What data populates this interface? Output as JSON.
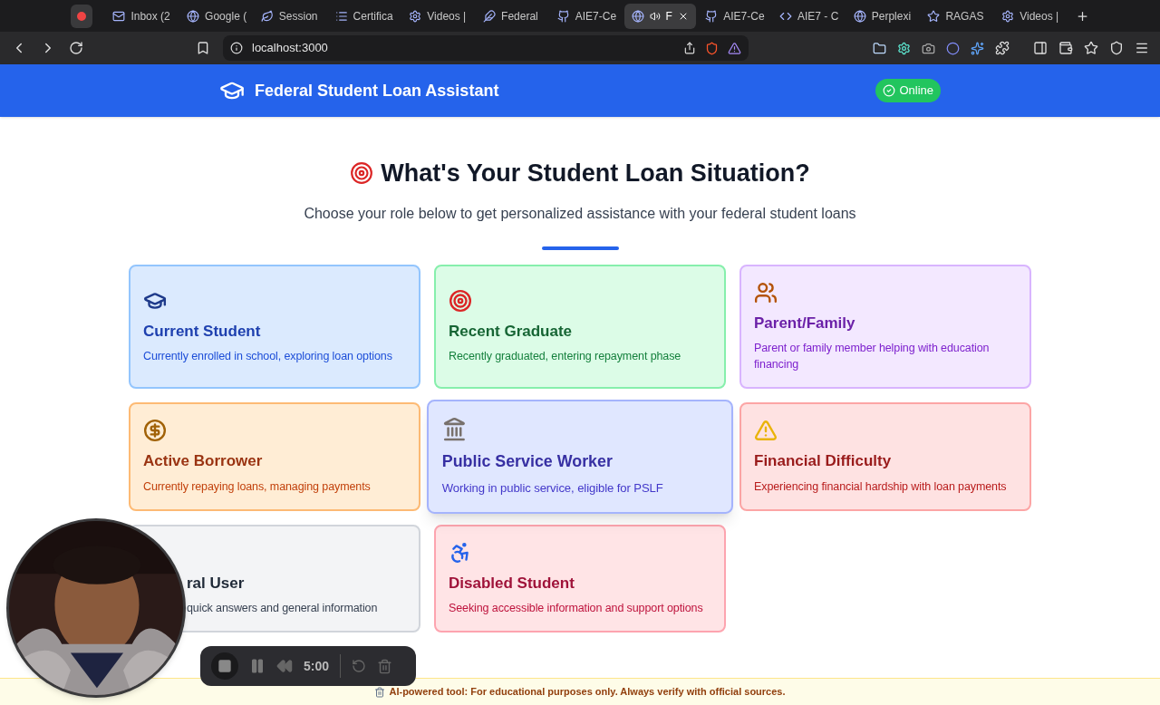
{
  "browser": {
    "tabs": [
      {
        "title": "Inbox (2",
        "selected": false
      },
      {
        "title": "Google (",
        "selected": false
      },
      {
        "title": "Session",
        "selected": false
      },
      {
        "title": "Certifica",
        "selected": false
      },
      {
        "title": "Videos |",
        "selected": false
      },
      {
        "title": "Federal",
        "selected": false
      },
      {
        "title": "AIE7-Ce",
        "selected": false
      },
      {
        "title": "F",
        "selected": true
      },
      {
        "title": "AIE7-Ce",
        "selected": false
      },
      {
        "title": "AIE7 - C",
        "selected": false
      },
      {
        "title": "Perplexi",
        "selected": false
      },
      {
        "title": "RAGAS",
        "selected": false
      },
      {
        "title": "Videos |",
        "selected": false
      }
    ],
    "url": "localhost:3000"
  },
  "header": {
    "title": "Federal Student Loan Assistant",
    "status": "Online",
    "online": true
  },
  "hero": {
    "title": "What's Your Student Loan Situation?",
    "subtitle": "Choose your role below to get personalized assistance with your federal student loans"
  },
  "roles": [
    {
      "title": "Current Student",
      "description": "Currently enrolled in school, exploring loan options",
      "hovered": false,
      "partially_hidden": false
    },
    {
      "title": "Recent Graduate",
      "description": "Recently graduated, entering repayment phase",
      "hovered": false,
      "partially_hidden": false
    },
    {
      "title": "Parent/Family",
      "description": "Parent or family member helping with education financing",
      "hovered": false,
      "partially_hidden": false
    },
    {
      "title": "Active Borrower",
      "description": "Currently repaying loans, managing payments",
      "hovered": false,
      "partially_hidden": false
    },
    {
      "title": "Public Service Worker",
      "description": "Working in public service, eligible for PSLF",
      "hovered": true,
      "partially_hidden": false
    },
    {
      "title": "Financial Difficulty",
      "description": "Experiencing financial hardship with loan payments",
      "hovered": false,
      "partially_hidden": false
    },
    {
      "title": "ral User",
      "description": "quick answers and general information",
      "hovered": false,
      "partially_hidden": true
    },
    {
      "title": "Disabled Student",
      "description": "Seeking accessible information and support options",
      "hovered": false,
      "partially_hidden": false
    }
  ],
  "footer": {
    "text": "AI-powered tool: For educational purposes only. Always verify with official sources."
  },
  "recorder": {
    "time": "5:00"
  }
}
